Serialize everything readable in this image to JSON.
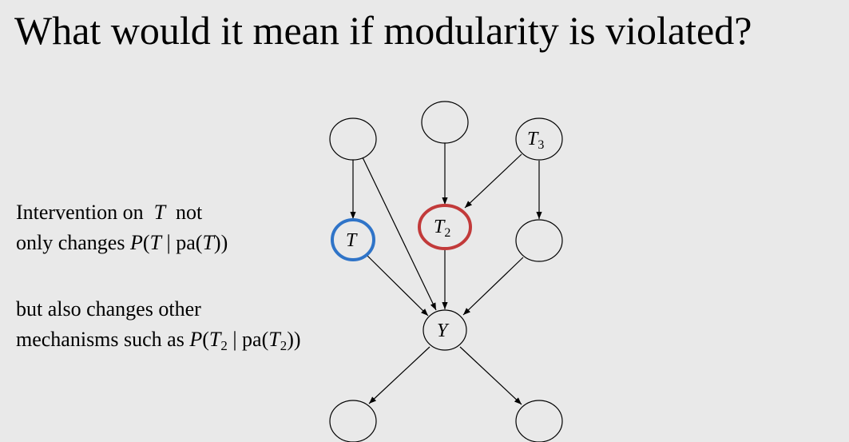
{
  "title": "What would it mean if modularity is violated?",
  "text1": {
    "line1_a": "Intervention on",
    "line1_var": "T",
    "line1_b": "not",
    "line2_a": "only changes",
    "line2_math": {
      "P": "P",
      "open": "(",
      "var": "T",
      "bar": " | ",
      "pa": "pa",
      "inner_open": "(",
      "inner_var": "T",
      "close": "))"
    }
  },
  "text2": {
    "line1": "but also changes other",
    "line2_a": "mechanisms such as",
    "line2_math": {
      "P": "P",
      "open": "(",
      "var": "T",
      "sub": "2",
      "bar": " | ",
      "pa": "pa",
      "inner_open": "(",
      "inner_var": "T",
      "inner_sub": "2",
      "close": "))"
    }
  },
  "diagram": {
    "nodes": {
      "t3": {
        "label": "T",
        "sub": "3"
      },
      "t": {
        "label": "T"
      },
      "t2": {
        "label": "T",
        "sub": "2"
      },
      "y": {
        "label": "Y"
      }
    },
    "colors": {
      "t_highlight": "#2f74c8",
      "t2_highlight": "#c23a3a",
      "stroke": "#000000"
    }
  }
}
